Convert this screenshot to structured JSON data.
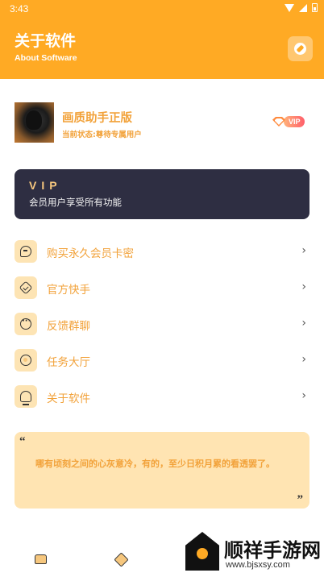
{
  "status_bar": {
    "time": "3:43"
  },
  "header": {
    "title": "关于软件",
    "subtitle": "About Software",
    "action_icon": "compass-icon",
    "background_color": "#FFAA24"
  },
  "profile": {
    "name": "画质助手正版",
    "status": "当前状态:尊待专属用户",
    "badge": "VIP"
  },
  "vip_card": {
    "title": "VIP",
    "description": "会员用户享受所有功能"
  },
  "menu": {
    "items": [
      {
        "label": "购买永久会员卡密",
        "icon": "chat-icon"
      },
      {
        "label": "官方快手",
        "icon": "badge-check-icon"
      },
      {
        "label": "反馈群聊",
        "icon": "dots-icon"
      },
      {
        "label": "任务大厅",
        "icon": "task-icon"
      },
      {
        "label": "关于软件",
        "icon": "about-icon"
      }
    ],
    "arrow": "›"
  },
  "quote": {
    "open_mark": "“",
    "text": "哪有顷刻之间的心灰意冷，有的，至少日积月累的看透罢了。",
    "close_mark": "”"
  },
  "bottom_nav": {
    "items": [
      {
        "icon": "home-icon"
      },
      {
        "icon": "favorite-icon"
      }
    ]
  },
  "watermark": {
    "text": "顺祥手游网",
    "url": "www.bjsxsy.com"
  }
}
